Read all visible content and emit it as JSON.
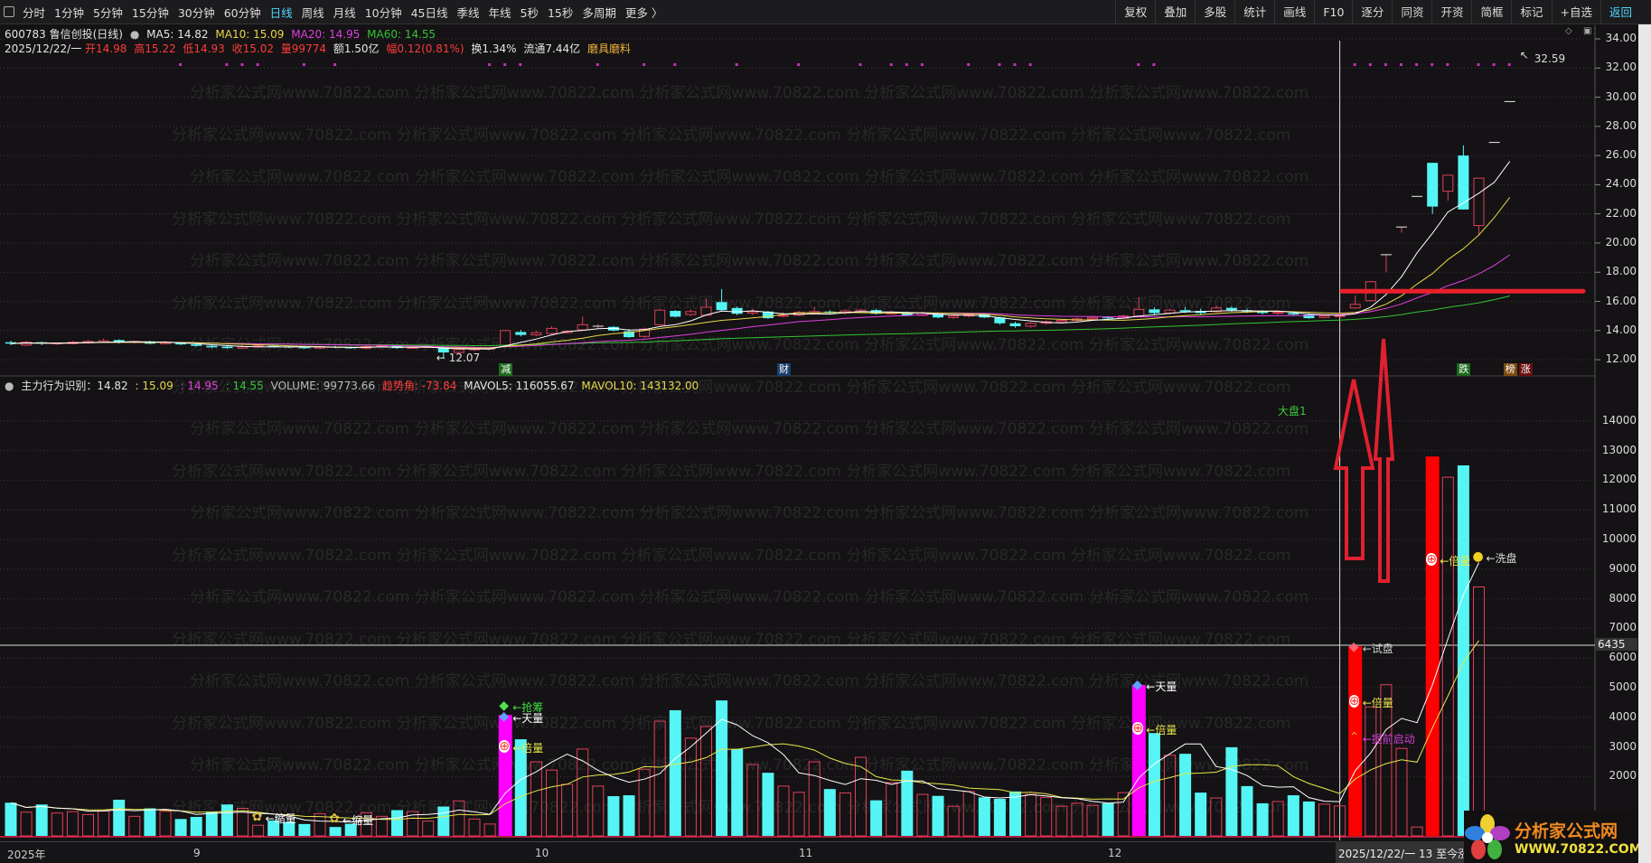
{
  "toolbar": {
    "periods": [
      "分时",
      "1分钟",
      "5分钟",
      "15分钟",
      "30分钟",
      "60分钟",
      "日线",
      "周线",
      "月线",
      "10分钟",
      "45日线",
      "季线",
      "年线",
      "5秒",
      "15秒",
      "多周期",
      "更多 〉"
    ],
    "active_period": "日线",
    "right": [
      "复权",
      "叠加",
      "多股",
      "统计",
      "画线",
      "F10",
      "逐分",
      "同资",
      "开资",
      "简框",
      "标记",
      "+自选",
      "返回"
    ]
  },
  "stock": {
    "title": "600783 鲁信创投(日线)",
    "ma5": "MA5: 14.82",
    "ma10": "MA10: 15.09",
    "ma20": "MA20: 14.95",
    "ma60": "MA60: 14.55",
    "date": "2025/12/22/一",
    "open": "开14.98",
    "high": "高15.22",
    "low": "低14.93",
    "close": "收15.02",
    "vol": "量99774",
    "amount": "额1.50亿",
    "change": "幅0.12(0.81%)",
    "turnover": "换1.34%",
    "float": "流通7.44亿",
    "industry": "磨具磨料"
  },
  "indicator": {
    "name": "主力行为识别：14.82",
    "v2": ": 15.09",
    "v3": ": 14.95",
    "v4": ": 14.55",
    "volume": "VOLUME: 99773.66",
    "trend": "趋势角: -73.84",
    "mavol5": "MAVOL5: 116055.67",
    "mavol10": "MAVOL10: 143132.00",
    "market_label": "大盘1"
  },
  "watermark": "分析家公式网www.70822.com 分析家公式网www.70822.com 分析家公式网www.70822.com 分析家公式网www.70822.com 分析家公式网www.70822.com",
  "price_axis": [
    "34.00",
    "32.00",
    "30.00",
    "28.00",
    "26.00",
    "24.00",
    "22.00",
    "20.00",
    "18.00",
    "16.00",
    "14.00",
    "12.00"
  ],
  "volume_axis": [
    "14000",
    "13000",
    "12000",
    "11000",
    "10000",
    "9000",
    "8000",
    "7000",
    "6000",
    "5000",
    "4000",
    "3000",
    "2000"
  ],
  "crosshair_value": "6435",
  "high_label": "32.59",
  "low_label": "12.07",
  "dates": {
    "y2025": "2025年",
    "sep": "9",
    "oct": "10",
    "nov": "11",
    "dec": "12",
    "cursor": "2025/12/22/一 13 至今涨"
  },
  "markers": [
    {
      "idx": 32,
      "text": "减",
      "bg": "#1d6a1d"
    },
    {
      "idx": 50,
      "text": "财",
      "bg": "#1a3f6a"
    },
    {
      "idx": 94,
      "text": "跌",
      "bg": "#1d6a1d"
    },
    {
      "idx": 97,
      "text": "榜",
      "bg": "#7a4a10"
    },
    {
      "idx": 98,
      "text": "涨",
      "bg": "#6a1010"
    }
  ],
  "signal_dots": [
    11,
    14,
    15,
    16,
    19,
    21,
    31,
    32,
    33,
    38,
    41,
    43,
    47,
    51,
    55,
    57,
    58,
    59,
    62,
    64,
    65,
    66,
    73,
    74,
    87,
    88,
    89,
    90,
    91,
    92,
    93,
    95,
    96,
    97
  ],
  "chart_data": {
    "type": "candlestick",
    "support_price": 16.7,
    "cursor_idx": 86,
    "candles": [
      [
        13.2,
        13.1,
        13.3,
        13.0
      ],
      [
        13.0,
        13.2,
        13.3,
        12.95
      ],
      [
        13.2,
        13.1,
        13.25,
        13.0
      ],
      [
        13.1,
        13.15,
        13.2,
        13.0
      ],
      [
        13.1,
        13.2,
        13.3,
        13.05
      ],
      [
        13.15,
        13.25,
        13.35,
        13.1
      ],
      [
        13.2,
        13.3,
        13.45,
        13.15
      ],
      [
        13.35,
        13.2,
        13.4,
        13.1
      ],
      [
        13.2,
        13.25,
        13.3,
        13.1
      ],
      [
        13.25,
        13.1,
        13.3,
        13.05
      ],
      [
        13.1,
        13.2,
        13.3,
        13.05
      ],
      [
        13.15,
        13.05,
        13.2,
        13.0
      ],
      [
        13.05,
        12.95,
        13.1,
        12.9
      ],
      [
        12.95,
        12.85,
        13.0,
        12.8
      ],
      [
        12.9,
        12.8,
        12.95,
        12.75
      ],
      [
        12.8,
        12.9,
        13.0,
        12.75
      ],
      [
        12.9,
        12.95,
        13.0,
        12.85
      ],
      [
        12.95,
        12.9,
        13.0,
        12.85
      ],
      [
        12.9,
        12.85,
        12.95,
        12.8
      ],
      [
        12.85,
        12.8,
        12.9,
        12.75
      ],
      [
        12.8,
        12.9,
        12.95,
        12.75
      ],
      [
        12.9,
        12.85,
        12.95,
        12.8
      ],
      [
        12.85,
        12.8,
        12.9,
        12.75
      ],
      [
        12.8,
        12.9,
        13.0,
        12.75
      ],
      [
        12.9,
        12.95,
        13.0,
        12.85
      ],
      [
        12.95,
        12.8,
        13.0,
        12.75
      ],
      [
        12.8,
        12.85,
        12.95,
        12.75
      ],
      [
        12.85,
        12.9,
        12.95,
        12.8
      ],
      [
        12.9,
        12.5,
        12.95,
        12.07
      ],
      [
        12.5,
        12.7,
        12.8,
        12.4
      ],
      [
        12.7,
        12.75,
        12.9,
        12.6
      ],
      [
        12.75,
        12.8,
        12.9,
        12.7
      ],
      [
        12.9,
        14.0,
        14.05,
        12.85
      ],
      [
        13.9,
        13.7,
        14.05,
        13.6
      ],
      [
        13.7,
        13.85,
        14.0,
        13.6
      ],
      [
        13.8,
        14.15,
        14.3,
        13.75
      ],
      [
        13.85,
        13.95,
        14.0,
        13.8
      ],
      [
        14.05,
        14.4,
        14.95,
        14.0
      ],
      [
        14.3,
        14.3,
        14.45,
        14.15
      ],
      [
        14.25,
        14.0,
        14.3,
        13.95
      ],
      [
        13.95,
        13.55,
        14.1,
        13.5
      ],
      [
        13.6,
        14.1,
        14.2,
        13.5
      ],
      [
        14.4,
        15.4,
        15.45,
        14.35
      ],
      [
        15.35,
        14.95,
        15.4,
        14.9
      ],
      [
        15.1,
        15.3,
        15.45,
        15.0
      ],
      [
        15.05,
        15.6,
        16.2,
        15.0
      ],
      [
        15.95,
        15.4,
        16.85,
        15.35
      ],
      [
        15.55,
        15.15,
        15.65,
        15.05
      ],
      [
        15.2,
        15.3,
        15.5,
        15.05
      ],
      [
        15.3,
        14.85,
        15.35,
        14.8
      ],
      [
        15.0,
        15.05,
        15.25,
        14.9
      ],
      [
        15.05,
        15.25,
        15.35,
        15.0
      ],
      [
        15.2,
        15.3,
        15.6,
        15.15
      ],
      [
        15.3,
        15.2,
        15.4,
        15.1
      ],
      [
        15.2,
        15.35,
        15.45,
        15.1
      ],
      [
        15.3,
        15.4,
        15.5,
        15.2
      ],
      [
        15.4,
        15.15,
        15.5,
        15.1
      ],
      [
        15.15,
        15.25,
        15.35,
        15.1
      ],
      [
        15.25,
        15.05,
        15.3,
        15.0
      ],
      [
        15.05,
        15.2,
        15.3,
        15.0
      ],
      [
        15.2,
        14.9,
        15.25,
        14.85
      ],
      [
        14.9,
        15.0,
        15.1,
        14.8
      ],
      [
        15.0,
        15.1,
        15.2,
        14.9
      ],
      [
        15.1,
        14.9,
        15.15,
        14.85
      ],
      [
        14.9,
        14.5,
        14.95,
        14.4
      ],
      [
        14.5,
        14.3,
        14.6,
        14.2
      ],
      [
        14.3,
        14.5,
        14.6,
        14.2
      ],
      [
        14.5,
        14.6,
        14.7,
        14.4
      ],
      [
        14.6,
        14.7,
        14.8,
        14.5
      ],
      [
        14.7,
        14.8,
        14.9,
        14.6
      ],
      [
        14.8,
        14.9,
        15.0,
        14.7
      ],
      [
        14.9,
        14.85,
        15.0,
        14.75
      ],
      [
        14.85,
        15.0,
        15.1,
        14.8
      ],
      [
        15.0,
        15.45,
        16.3,
        14.95
      ],
      [
        15.45,
        15.2,
        15.6,
        15.1
      ],
      [
        15.2,
        15.4,
        15.5,
        15.1
      ],
      [
        15.4,
        15.3,
        15.6,
        15.2
      ],
      [
        15.35,
        15.2,
        15.5,
        15.1
      ],
      [
        15.3,
        15.55,
        15.7,
        15.2
      ],
      [
        15.55,
        15.4,
        15.65,
        15.3
      ],
      [
        15.4,
        15.3,
        15.5,
        15.2
      ],
      [
        15.3,
        15.2,
        15.4,
        15.1
      ],
      [
        15.2,
        15.25,
        15.35,
        15.1
      ],
      [
        15.2,
        15.1,
        15.3,
        15.0
      ],
      [
        15.1,
        14.85,
        15.2,
        14.8
      ],
      [
        14.9,
        15.0,
        15.1,
        14.85
      ],
      [
        14.98,
        15.02,
        15.22,
        14.93
      ],
      [
        15.55,
        15.8,
        16.4,
        15.5
      ],
      [
        16.05,
        17.35,
        17.4,
        16.0
      ],
      [
        19.2,
        19.2,
        19.2,
        18.0
      ],
      [
        21.1,
        21.1,
        21.1,
        20.7
      ],
      [
        23.2,
        23.2,
        23.2,
        23.2
      ],
      [
        25.5,
        22.5,
        25.5,
        22.0
      ],
      [
        23.55,
        24.65,
        24.65,
        22.9
      ],
      [
        26.0,
        22.3,
        26.7,
        22.3
      ],
      [
        21.2,
        24.45,
        24.45,
        20.6
      ],
      [
        26.9,
        26.9,
        26.9,
        26.9
      ],
      [
        29.7,
        29.7,
        29.7,
        29.7
      ]
    ],
    "volume": [
      1120,
      800,
      1060,
      770,
      820,
      720,
      840,
      1220,
      660,
      930,
      830,
      570,
      640,
      820,
      1060,
      930,
      360,
      520,
      470,
      400,
      750,
      300,
      410,
      780,
      660,
      870,
      820,
      500,
      990,
      1180,
      570,
      400,
      4080,
      3260,
      2500,
      2220,
      1740,
      2930,
      1680,
      1340,
      1370,
      2250,
      3870,
      4240,
      3300,
      3690,
      4570,
      2930,
      2410,
      2130,
      1680,
      1470,
      2500,
      1580,
      1450,
      2650,
      1200,
      1800,
      2200,
      1400,
      1350,
      1000,
      1500,
      1300,
      1250,
      1500,
      1400,
      1300,
      1000,
      1100,
      1030,
      1100,
      1460,
      5090,
      3470,
      2720,
      2770,
      1460,
      1280,
      2990,
      1680,
      1100,
      1160,
      1370,
      1160,
      1070,
      1010,
      6400,
      4350,
      5100,
      2950,
      300,
      12800,
      12100,
      12500,
      8400,
      null,
      null
    ],
    "volume_ylim": [
      0,
      14000
    ],
    "price_ylim": [
      12,
      34
    ],
    "special_bars": {
      "32": "#ff00ff",
      "73": "#ff00ff",
      "87": "#ff0000",
      "92": "#ff0000"
    },
    "annotations": [
      {
        "idx": 32,
        "value": 4350,
        "text": "←抢筹",
        "color": "#3fdc3f",
        "icon": "diamond-green"
      },
      {
        "idx": 32,
        "value": 4000,
        "text": "←天量",
        "color": "#ffffff",
        "icon": "diamond-blue"
      },
      {
        "idx": 32,
        "value": 3000,
        "text": "←倍量",
        "color": "#e8e84a",
        "icon": "plus"
      },
      {
        "idx": 73,
        "value": 5050,
        "text": "←天量",
        "color": "#ffffff",
        "icon": "diamond-blue"
      },
      {
        "idx": 73,
        "value": 3600,
        "text": "←倍量",
        "color": "#e8e84a",
        "icon": "plus"
      },
      {
        "idx": 87,
        "value": 6350,
        "text": "←试盘",
        "color": "#cccccc",
        "icon": "diamond-red"
      },
      {
        "idx": 87,
        "value": 4500,
        "text": "←倍量",
        "color": "#e8e84a",
        "icon": "plus"
      },
      {
        "idx": 87,
        "value": 3300,
        "text": "←提前启动",
        "color": "#d040d0",
        "icon": "up"
      },
      {
        "idx": 92,
        "value": 9300,
        "text": "←倍量",
        "color": "#e8e84a",
        "icon": "plus"
      },
      {
        "idx": 95,
        "value": 9400,
        "text": "←洗盘",
        "color": "#dddddd",
        "icon": "dot"
      },
      {
        "idx": 16,
        "value": 600,
        "text": "←缩量",
        "color": "#ffffff",
        "icon": "flower"
      },
      {
        "idx": 21,
        "value": 550,
        "text": "←缩量",
        "color": "#ffffff",
        "icon": "flower"
      }
    ]
  },
  "logo": {
    "name": "分析家公式网",
    "url": "WWW.70822.COM"
  }
}
